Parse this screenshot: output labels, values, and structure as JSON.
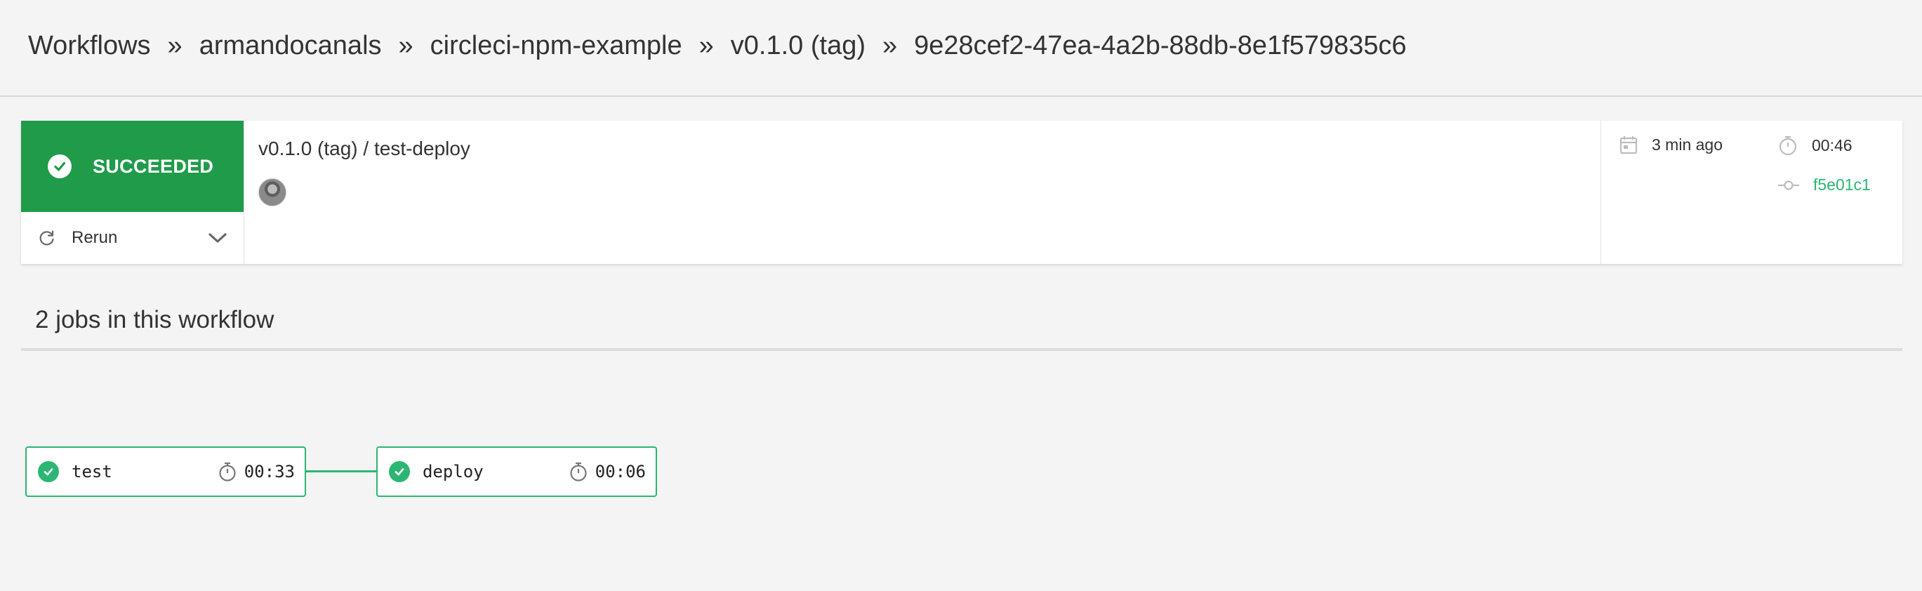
{
  "breadcrumb": {
    "items": [
      "Workflows",
      "armandocanals",
      "circleci-npm-example",
      "v0.1.0 (tag)",
      "9e28cef2-47ea-4a2b-88db-8e1f579835c6"
    ],
    "separator": "»"
  },
  "summary": {
    "status": "SUCCEEDED",
    "status_color": "#1f9b4a",
    "rerun_label": "Rerun",
    "workflow_name": "v0.1.0 (tag) / test-deploy",
    "started": "3 min ago",
    "duration": "00:46",
    "commit": "f5e01c1"
  },
  "jobs": {
    "title": "2 jobs in this workflow",
    "items": [
      {
        "name": "test",
        "duration": "00:33",
        "status": "success"
      },
      {
        "name": "deploy",
        "duration": "00:06",
        "status": "success"
      }
    ]
  },
  "icons": {
    "status": "check-circle-icon",
    "rerun": "refresh-icon",
    "dropdown": "chevron-down-icon",
    "started": "calendar-icon",
    "duration": "stopwatch-icon",
    "commit": "git-commit-icon"
  },
  "colors": {
    "success": "#2bb673",
    "accent": "#1f9b4a"
  }
}
